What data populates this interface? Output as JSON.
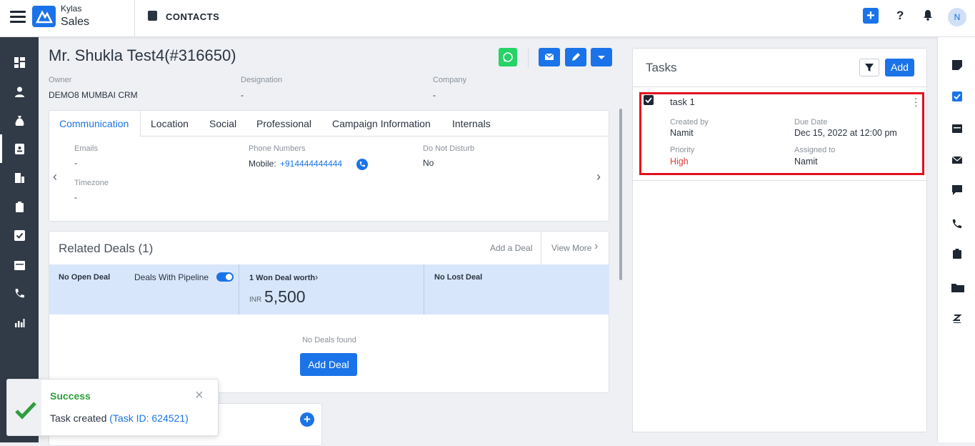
{
  "app": {
    "brand_top": "Kylas",
    "brand_main": "Sales",
    "module_title": "CONTACTS",
    "user_initial": "N",
    "accent": "#1a73e8"
  },
  "contact": {
    "name": "Mr. Shukla Test4(#316650)",
    "fields": [
      {
        "label": "Owner",
        "value": "DEMO8 MUMBAI CRM"
      },
      {
        "label": "Designation",
        "value": "-"
      },
      {
        "label": "Company",
        "value": "-"
      }
    ]
  },
  "tabs": [
    "Communication",
    "Location",
    "Social",
    "Professional",
    "Campaign Information",
    "Internals"
  ],
  "communication": {
    "emails_label": "Emails",
    "emails_value": "-",
    "phones_label": "Phone Numbers",
    "phone_type": "Mobile:",
    "phone_value": "+914444444444",
    "dnd_label": "Do Not Disturb",
    "dnd_value": "No",
    "timezone_label": "Timezone",
    "timezone_value": "-"
  },
  "deals": {
    "title": "Related Deals (1)",
    "add_link": "Add a Deal",
    "view_more": "View More",
    "open_label": "No Open Deal",
    "pipeline_label": "Deals With Pipeline",
    "pipeline_on": true,
    "won_label": "1 Won Deal worth",
    "won_currency": "INR",
    "won_amount": "5,500",
    "lost_label": "No Lost Deal",
    "empty_text": "No Deals found",
    "add_button": "Add Deal"
  },
  "tasks": {
    "title": "Tasks",
    "add_button": "Add",
    "item": {
      "name": "task 1",
      "created_by_label": "Created by",
      "created_by": "Namit",
      "due_label": "Due Date",
      "due": "Dec 15, 2022 at 12:00 pm",
      "priority_label": "Priority",
      "priority": "High",
      "priority_color": "#e53935",
      "assigned_label": "Assigned to",
      "assigned": "Namit"
    }
  },
  "toast": {
    "title": "Success",
    "message": "Task created",
    "link": "(Task ID: 624521)",
    "success_color": "#2e9e3e"
  },
  "left_nav_icons": [
    "dashboard-icon",
    "user-icon",
    "money-bag-icon",
    "contacts-icon",
    "company-icon",
    "clipboard-icon",
    "check-icon",
    "calendar-icon",
    "phone-icon",
    "report-icon"
  ],
  "right_nav_icons": [
    "notes-icon",
    "tasks-icon",
    "calendar-icon",
    "email-icon",
    "chat-icon",
    "call-icon",
    "quote-icon",
    "folder-icon",
    "zendesk-icon"
  ]
}
